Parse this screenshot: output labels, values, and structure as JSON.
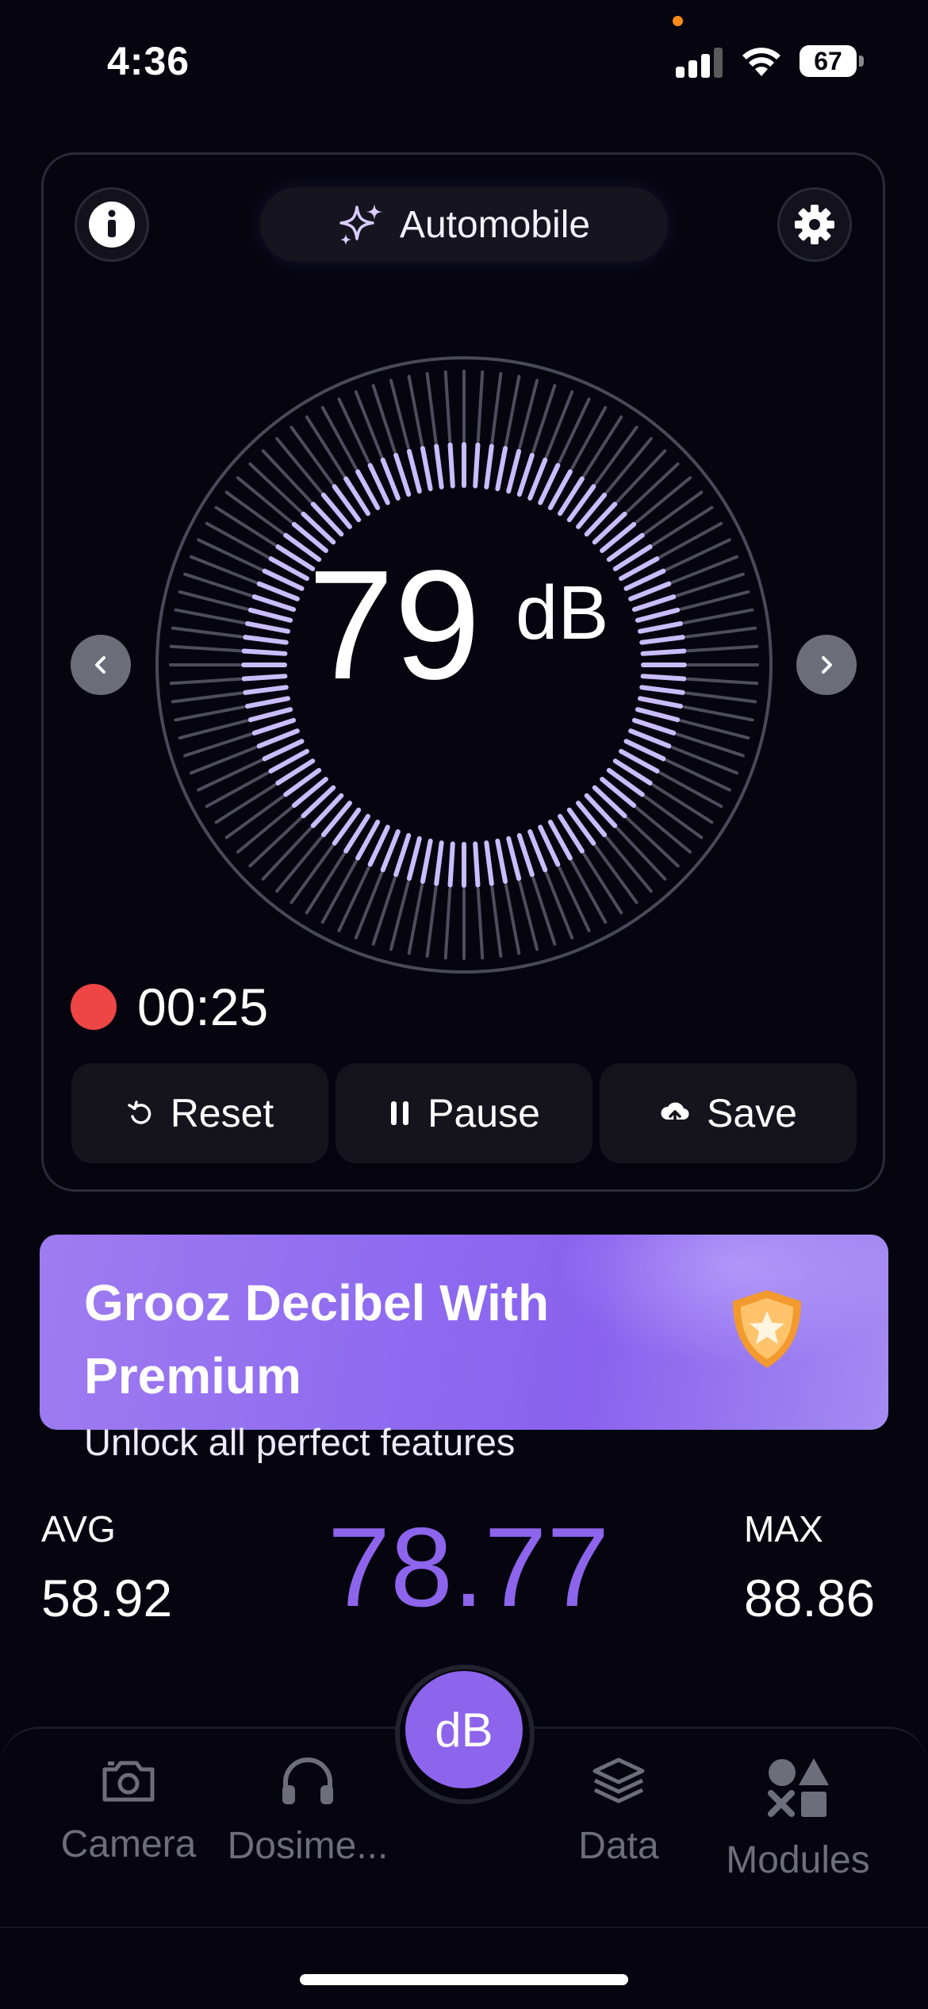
{
  "status_bar": {
    "time": "4:36",
    "battery": "67"
  },
  "meter": {
    "mode_label": "Automobile",
    "reading": "79",
    "unit": "dB",
    "timer": "00:25",
    "controls": {
      "reset": "Reset",
      "pause": "Pause",
      "save": "Save"
    }
  },
  "premium": {
    "title": "Grooz Decibel With Premium",
    "subtitle": "Unlock all perfect features"
  },
  "stats": {
    "avg_label": "AVG",
    "avg_value": "58.92",
    "current_value": "78.77",
    "max_label": "MAX",
    "max_value": "88.86"
  },
  "tabbar": {
    "camera": "Camera",
    "dosimeter": "Dosime...",
    "center": "dB",
    "data": "Data",
    "modules": "Modules"
  },
  "colors": {
    "background": "#05040f",
    "accent": "#8d64ec",
    "dial_active": "#c9bdff",
    "record": "#ee4545"
  }
}
